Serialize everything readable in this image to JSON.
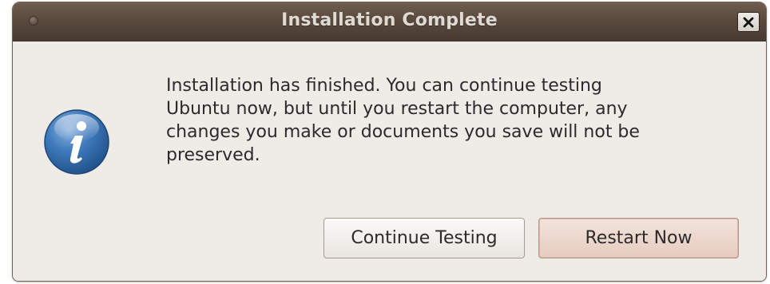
{
  "window": {
    "title": "Installation Complete",
    "close_glyph": "close-icon"
  },
  "dialog": {
    "icon": "info-icon",
    "message": "Installation has finished.  You can continue testing\nUbuntu now, but until you restart the computer, any\nchanges you make or documents you save will not be\npreserved."
  },
  "buttons": {
    "continue_label": "Continue Testing",
    "restart_label": "Restart Now"
  },
  "colors": {
    "titlebar": "#5a4a3e",
    "title_text": "#dfdbd2",
    "dialog_bg": "#efebe7",
    "default_button": "#e6cbbf",
    "info_icon": "#2f6aa8"
  }
}
